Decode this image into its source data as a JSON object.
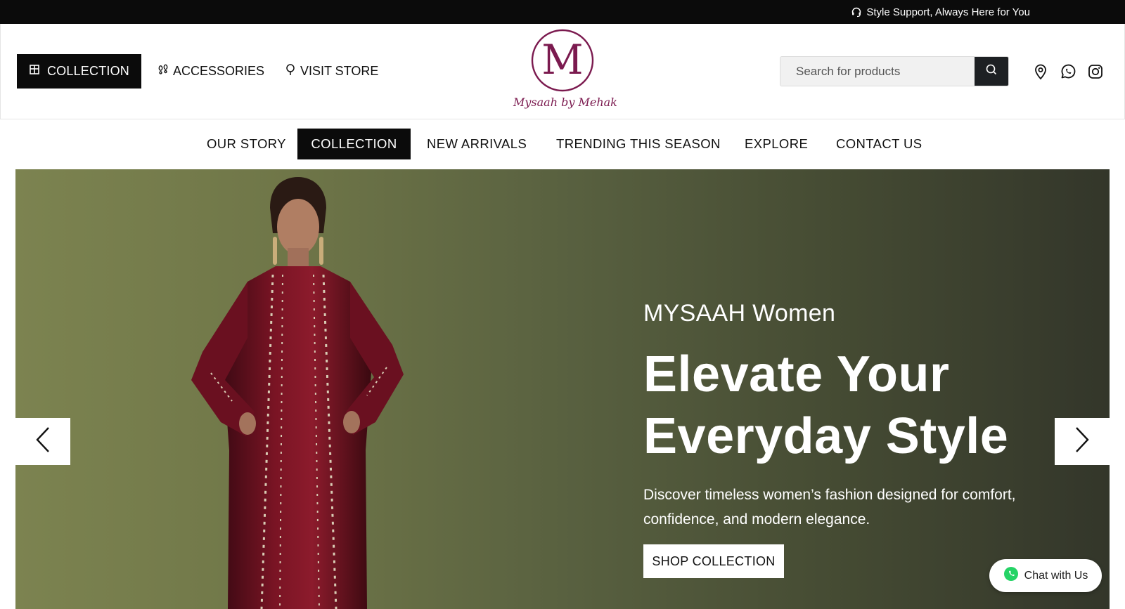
{
  "announcement": {
    "text": "Style Support, Always Here for You",
    "icon": "headset-icon"
  },
  "header": {
    "collection_button": "COLLECTION",
    "accessories_link": "ACCESSORIES",
    "store_link": "VISIT STORE",
    "logo_caption": "Mysaah by Mehak",
    "logo_letter": "M",
    "search": {
      "placeholder": "Search for products"
    },
    "icons": [
      "location-pin-icon",
      "whatsapp-icon",
      "instagram-icon"
    ]
  },
  "nav": {
    "items": [
      {
        "label": "OUR STORY"
      },
      {
        "label": "COLLECTION",
        "active": true
      },
      {
        "label": "NEW ARRIVALS"
      },
      {
        "label": "TRENDING THIS SEASON"
      },
      {
        "label": "EXPLORE"
      },
      {
        "label": "CONTACT US"
      }
    ]
  },
  "hero": {
    "eyebrow": "MYSAAH Women",
    "title_line1": "Elevate Your",
    "title_line2": "Everyday Style",
    "desc_line1": "Discover timeless women’s fashion designed for comfort,",
    "desc_line2": "confidence, and modern elegance.",
    "cta": "SHOP COLLECTION"
  },
  "chat": {
    "label": "Chat with Us"
  },
  "colors": {
    "brand": "#7b1a4f",
    "dark": "#0b0b0b",
    "hero_left": "#7c8350",
    "hero_right": "#33362a",
    "whatsapp": "#25d366"
  }
}
